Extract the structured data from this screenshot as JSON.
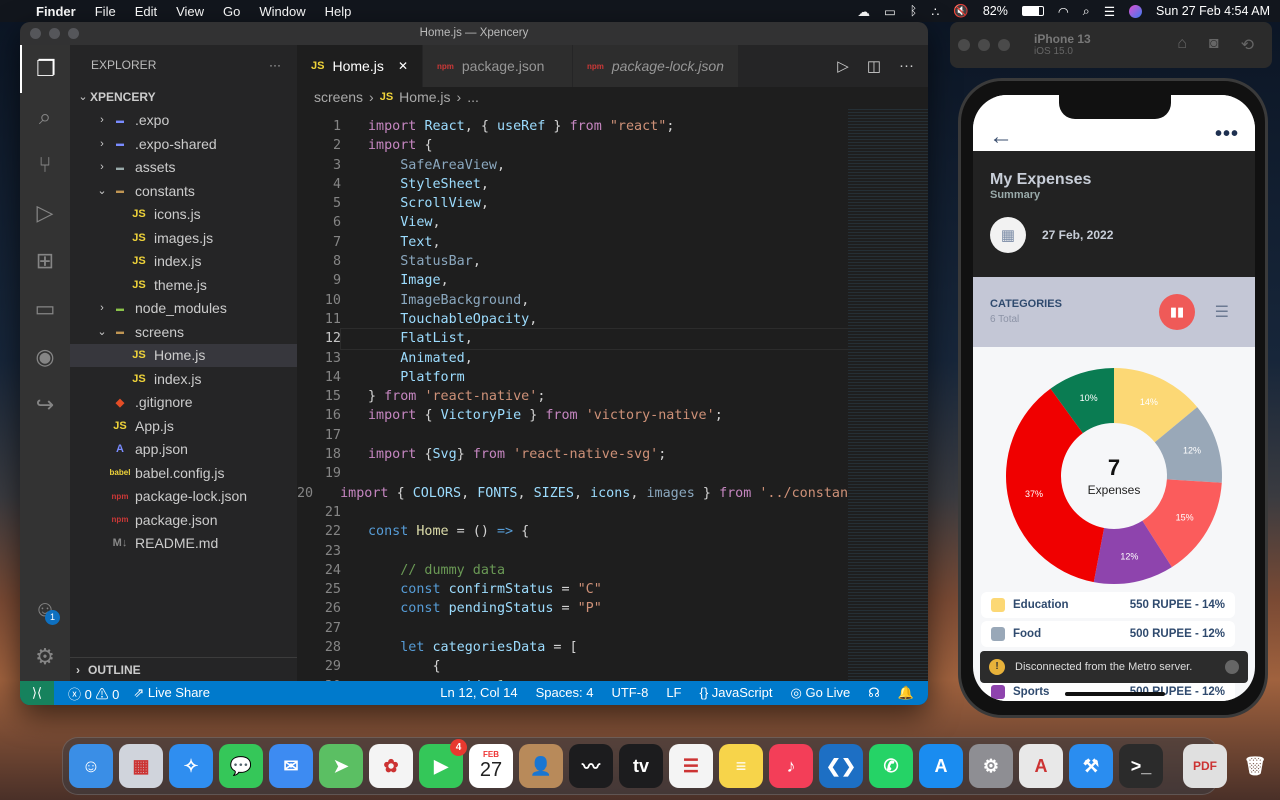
{
  "menubar": {
    "app": "Finder",
    "items": [
      "File",
      "Edit",
      "View",
      "Go",
      "Window",
      "Help"
    ],
    "battery": "82%",
    "datetime": "Sun 27 Feb  4:54 AM"
  },
  "vscode": {
    "title": "Home.js — Xpencery",
    "explorer_label": "EXPLORER",
    "explorer_more": "···",
    "tree": [
      {
        "label": "XPENCERY",
        "depth": 0,
        "chev": "⌄",
        "icon": "",
        "root": true
      },
      {
        "label": ".expo",
        "depth": 1,
        "chev": "›",
        "icon": "folder",
        "color": "#7a8cff"
      },
      {
        "label": ".expo-shared",
        "depth": 1,
        "chev": "›",
        "icon": "folder",
        "color": "#7a8cff"
      },
      {
        "label": "assets",
        "depth": 1,
        "chev": "›",
        "icon": "folder",
        "color": "#9aa"
      },
      {
        "label": "constants",
        "depth": 1,
        "chev": "⌄",
        "icon": "folder",
        "color": "#c09553"
      },
      {
        "label": "icons.js",
        "depth": 2,
        "chev": "",
        "icon": "JS",
        "color": "#f0d43a"
      },
      {
        "label": "images.js",
        "depth": 2,
        "chev": "",
        "icon": "JS",
        "color": "#f0d43a"
      },
      {
        "label": "index.js",
        "depth": 2,
        "chev": "",
        "icon": "JS",
        "color": "#f0d43a"
      },
      {
        "label": "theme.js",
        "depth": 2,
        "chev": "",
        "icon": "JS",
        "color": "#f0d43a"
      },
      {
        "label": "node_modules",
        "depth": 1,
        "chev": "›",
        "icon": "folder",
        "color": "#8bc34a"
      },
      {
        "label": "screens",
        "depth": 1,
        "chev": "⌄",
        "icon": "folder",
        "color": "#c09553"
      },
      {
        "label": "Home.js",
        "depth": 2,
        "chev": "",
        "icon": "JS",
        "color": "#f0d43a",
        "selected": true
      },
      {
        "label": "index.js",
        "depth": 2,
        "chev": "",
        "icon": "JS",
        "color": "#f0d43a"
      },
      {
        "label": ".gitignore",
        "depth": 1,
        "chev": "",
        "icon": "◆",
        "color": "#e44d26"
      },
      {
        "label": "App.js",
        "depth": 1,
        "chev": "",
        "icon": "JS",
        "color": "#f0d43a"
      },
      {
        "label": "app.json",
        "depth": 1,
        "chev": "",
        "icon": "A",
        "color": "#7a8cff"
      },
      {
        "label": "babel.config.js",
        "depth": 1,
        "chev": "",
        "icon": "babel",
        "color": "#f0d43a"
      },
      {
        "label": "package-lock.json",
        "depth": 1,
        "chev": "",
        "icon": "npm",
        "color": "#cb3837"
      },
      {
        "label": "package.json",
        "depth": 1,
        "chev": "",
        "icon": "npm",
        "color": "#cb3837"
      },
      {
        "label": "README.md",
        "depth": 1,
        "chev": "",
        "icon": "M↓",
        "color": "#888"
      }
    ],
    "outline": "OUTLINE",
    "tabs": [
      {
        "label": "Home.js",
        "icon": "JS",
        "color": "#f0d43a",
        "active": true,
        "close": "✕"
      },
      {
        "label": "package.json",
        "icon": "npm",
        "color": "#cb3837"
      },
      {
        "label": "package-lock.json",
        "icon": "npm",
        "color": "#cb3837",
        "italic": true
      }
    ],
    "breadcrumb": [
      "screens",
      "›",
      "JS",
      "Home.js",
      "›",
      "..."
    ],
    "current_line": 12,
    "code": [
      [
        [
          "kw",
          "import "
        ],
        [
          "id",
          "React"
        ],
        [
          "pl",
          ", { "
        ],
        [
          "id",
          "useRef"
        ],
        [
          "pl",
          " } "
        ],
        [
          "kw",
          "from "
        ],
        [
          "str",
          "\"react\""
        ],
        [
          "pl",
          ";"
        ]
      ],
      [
        [
          "kw",
          "import "
        ],
        [
          "pl",
          "{"
        ]
      ],
      [
        [
          "pl",
          "    "
        ],
        [
          "dim",
          "SafeAreaView"
        ],
        [
          "pl",
          ","
        ]
      ],
      [
        [
          "pl",
          "    "
        ],
        [
          "id",
          "StyleSheet"
        ],
        [
          "pl",
          ","
        ]
      ],
      [
        [
          "pl",
          "    "
        ],
        [
          "id",
          "ScrollView"
        ],
        [
          "pl",
          ","
        ]
      ],
      [
        [
          "pl",
          "    "
        ],
        [
          "id",
          "View"
        ],
        [
          "pl",
          ","
        ]
      ],
      [
        [
          "pl",
          "    "
        ],
        [
          "id",
          "Text"
        ],
        [
          "pl",
          ","
        ]
      ],
      [
        [
          "pl",
          "    "
        ],
        [
          "dim",
          "StatusBar"
        ],
        [
          "pl",
          ","
        ]
      ],
      [
        [
          "pl",
          "    "
        ],
        [
          "id",
          "Image"
        ],
        [
          "pl",
          ","
        ]
      ],
      [
        [
          "pl",
          "    "
        ],
        [
          "dim",
          "ImageBackground"
        ],
        [
          "pl",
          ","
        ]
      ],
      [
        [
          "pl",
          "    "
        ],
        [
          "id",
          "TouchableOpacity"
        ],
        [
          "pl",
          ","
        ]
      ],
      [
        [
          "pl",
          "    "
        ],
        [
          "id",
          "FlatList"
        ],
        [
          "pl",
          ","
        ]
      ],
      [
        [
          "pl",
          "    "
        ],
        [
          "id",
          "Animated"
        ],
        [
          "pl",
          ","
        ]
      ],
      [
        [
          "pl",
          "    "
        ],
        [
          "id",
          "Platform"
        ]
      ],
      [
        [
          "pl",
          "} "
        ],
        [
          "kw",
          "from "
        ],
        [
          "str",
          "'react-native'"
        ],
        [
          "pl",
          ";"
        ]
      ],
      [
        [
          "kw",
          "import "
        ],
        [
          "pl",
          "{ "
        ],
        [
          "id",
          "VictoryPie"
        ],
        [
          "pl",
          " } "
        ],
        [
          "kw",
          "from "
        ],
        [
          "str",
          "'victory-native'"
        ],
        [
          "pl",
          ";"
        ]
      ],
      [],
      [
        [
          "kw",
          "import "
        ],
        [
          "pl",
          "{"
        ],
        [
          "id",
          "Svg"
        ],
        [
          "pl",
          "} "
        ],
        [
          "kw",
          "from "
        ],
        [
          "str",
          "'react-native-svg'"
        ],
        [
          "pl",
          ";"
        ]
      ],
      [],
      [
        [
          "kw",
          "import "
        ],
        [
          "pl",
          "{ "
        ],
        [
          "id",
          "COLORS"
        ],
        [
          "pl",
          ", "
        ],
        [
          "id",
          "FONTS"
        ],
        [
          "pl",
          ", "
        ],
        [
          "id",
          "SIZES"
        ],
        [
          "pl",
          ", "
        ],
        [
          "id",
          "icons"
        ],
        [
          "pl",
          ", "
        ],
        [
          "dim",
          "images"
        ],
        [
          "pl",
          " } "
        ],
        [
          "kw",
          "from "
        ],
        [
          "str",
          "'../constants'"
        ]
      ],
      [],
      [
        [
          "dk",
          "const "
        ],
        [
          "fn",
          "Home"
        ],
        [
          "pl",
          " = () "
        ],
        [
          "dk",
          "=>"
        ],
        [
          "pl",
          " {"
        ]
      ],
      [],
      [
        [
          "pl",
          "    "
        ],
        [
          "cm",
          "// dummy data"
        ]
      ],
      [
        [
          "pl",
          "    "
        ],
        [
          "dk",
          "const "
        ],
        [
          "id",
          "confirmStatus"
        ],
        [
          "pl",
          " = "
        ],
        [
          "str",
          "\"C\""
        ]
      ],
      [
        [
          "pl",
          "    "
        ],
        [
          "dk",
          "const "
        ],
        [
          "id",
          "pendingStatus"
        ],
        [
          "pl",
          " = "
        ],
        [
          "str",
          "\"P\""
        ]
      ],
      [],
      [
        [
          "pl",
          "    "
        ],
        [
          "dk",
          "let "
        ],
        [
          "id",
          "categoriesData"
        ],
        [
          "pl",
          " = ["
        ]
      ],
      [
        [
          "pl",
          "        {"
        ]
      ],
      [
        [
          "pl",
          "            "
        ],
        [
          "id",
          "id"
        ],
        [
          "pl",
          ": "
        ],
        [
          "nm",
          "1"
        ],
        [
          "pl",
          ","
        ]
      ]
    ],
    "status": {
      "errors": "0",
      "warnings": "0",
      "live_share": "Live Share",
      "position": "Ln 12, Col 14",
      "spaces": "Spaces: 4",
      "encoding": "UTF-8",
      "eol": "LF",
      "language": "JavaScript",
      "go_live": "Go Live"
    },
    "accounts_badge": "1"
  },
  "simulator": {
    "device": "iPhone 13",
    "os": "iOS 15.0"
  },
  "phone": {
    "title": "My Expenses",
    "subtitle": "Summary",
    "date": "27 Feb, 2022",
    "categories_title": "CATEGORIES",
    "categories_count": "6 Total",
    "center_value": "7",
    "center_label": "Expenses",
    "pie": [
      {
        "percent": 14,
        "label": "14%",
        "color": "#fcd875"
      },
      {
        "percent": 12,
        "label": "12%",
        "color": "#99a8b8"
      },
      {
        "percent": 15,
        "label": "15%",
        "color": "#fb5c5c"
      },
      {
        "percent": 12,
        "label": "12%",
        "color": "#8e44ad"
      },
      {
        "percent": 37,
        "label": "37%",
        "color": "#f00000"
      },
      {
        "percent": 10,
        "label": "10%",
        "color": "#0a7c52"
      }
    ],
    "legend": [
      {
        "name": "Education",
        "value": "550 RUPEE - 14%",
        "color": "#fcd875"
      },
      {
        "name": "Food",
        "value": "500 RUPEE - 12%",
        "color": "#99a8b8"
      },
      {
        "name": "Sports",
        "value": "500 RUPEE - 12%",
        "color": "#8e44ad"
      }
    ],
    "toast": "Disconnected from the Metro server.",
    "toast_icon": "!"
  },
  "dock": [
    {
      "name": "finder",
      "bg": "#3a8ee6",
      "glyph": "☺"
    },
    {
      "name": "launchpad",
      "bg": "#d0d4dc",
      "glyph": "▦"
    },
    {
      "name": "safari",
      "bg": "#2f8ef0",
      "glyph": "✧"
    },
    {
      "name": "messages",
      "bg": "#35c759",
      "glyph": "💬"
    },
    {
      "name": "mail",
      "bg": "#3d8bf2",
      "glyph": "✉"
    },
    {
      "name": "maps",
      "bg": "#5bbf63",
      "glyph": "➤"
    },
    {
      "name": "photos",
      "bg": "#f4f4f4",
      "glyph": "✿"
    },
    {
      "name": "facetime",
      "bg": "#34c759",
      "glyph": "▶",
      "badge": "4"
    },
    {
      "name": "calendar",
      "calendar": true,
      "month": "FEB",
      "day": "27"
    },
    {
      "name": "contacts",
      "bg": "#b88a5a",
      "glyph": "👤"
    },
    {
      "name": "stocks",
      "bg": "#1c1c1e",
      "glyph": "〰"
    },
    {
      "name": "apple-tv",
      "bg": "#1c1c1e",
      "glyph": "tv"
    },
    {
      "name": "reminders",
      "bg": "#f4f4f4",
      "glyph": "☰"
    },
    {
      "name": "notes",
      "bg": "#f7d44a",
      "glyph": "≡"
    },
    {
      "name": "music",
      "bg": "#f33e58",
      "glyph": "♪"
    },
    {
      "name": "vscode",
      "bg": "#1d6fc4",
      "glyph": "❮❯"
    },
    {
      "name": "whatsapp",
      "bg": "#25d366",
      "glyph": "✆"
    },
    {
      "name": "app-store",
      "bg": "#1a8cf0",
      "glyph": "A"
    },
    {
      "name": "system-preferences",
      "bg": "#8e8e93",
      "glyph": "⚙"
    },
    {
      "name": "acrobat",
      "bg": "#e8e8e8",
      "glyph": "A"
    },
    {
      "name": "xcode-simulator",
      "bg": "#2a8df0",
      "glyph": "⚒"
    },
    {
      "name": "terminal",
      "bg": "#2b2b2b",
      "glyph": ">_"
    },
    {
      "sep": true
    },
    {
      "name": "pdf-document",
      "bg": "#e0e0e0",
      "glyph": "PDF"
    },
    {
      "name": "trash",
      "bg": "transparent",
      "glyph": "🗑"
    }
  ]
}
